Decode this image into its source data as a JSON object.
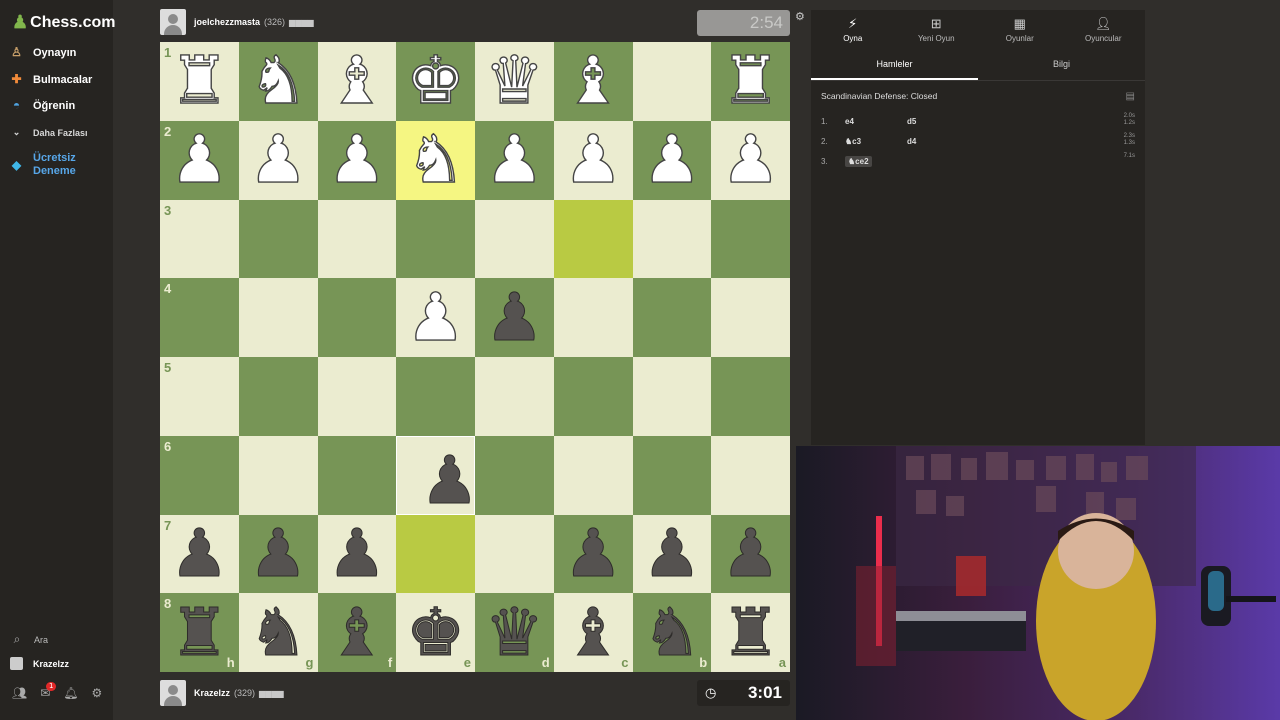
{
  "sidebar": {
    "logo": "Chess.com",
    "items": [
      {
        "label": "Oynayın",
        "icon": "play-icon"
      },
      {
        "label": "Bulmacalar",
        "icon": "puzzle-icon"
      },
      {
        "label": "Öğrenin",
        "icon": "learn-icon"
      },
      {
        "label": "Daha Fazlası",
        "icon": "chevron-down-icon"
      },
      {
        "label": "Ücretsiz Deneme",
        "icon": "diamond-icon"
      }
    ],
    "search_label": "Ara",
    "username": "Krazelzz",
    "notification_count": "1"
  },
  "top_player": {
    "name": "joelchezzmasta",
    "rating": "(326)",
    "clock": "2:54"
  },
  "bottom_player": {
    "name": "Krazelzz",
    "rating": "(329)",
    "clock": "3:01"
  },
  "board": {
    "orientation": "black",
    "ranks": [
      "1",
      "2",
      "3",
      "4",
      "5",
      "6",
      "7",
      "8"
    ],
    "files": [
      "h",
      "g",
      "f",
      "e",
      "d",
      "c",
      "b",
      "a"
    ],
    "pieces": [
      [
        "♜w",
        "♞w",
        "♝w",
        "♚w",
        "♛w",
        "♝w",
        "",
        "♜w"
      ],
      [
        "♟w",
        "♟w",
        "♟w",
        "♞w",
        "♟w",
        "♟w",
        "♟w",
        "♟w"
      ],
      [
        "",
        "",
        "",
        "",
        "",
        "",
        "",
        ""
      ],
      [
        "",
        "",
        "",
        "♟w",
        "♟b",
        "",
        "",
        ""
      ],
      [
        "",
        "",
        "",
        "",
        "",
        "",
        "",
        ""
      ],
      [
        "",
        "",
        "",
        "♟b",
        "",
        "",
        "",
        ""
      ],
      [
        "♟b",
        "♟b",
        "♟b",
        "",
        "",
        "♟b",
        "♟b",
        "♟b"
      ],
      [
        "♜b",
        "♞b",
        "♝b",
        "♚b",
        "♛b",
        "♝b",
        "♞b",
        "♜b"
      ]
    ],
    "highlight_last_move": [
      [
        1,
        3
      ]
    ],
    "highlight_selected": [
      [
        2,
        5
      ],
      [
        6,
        3
      ]
    ],
    "dragging_square": [
      5,
      3
    ]
  },
  "right_panel": {
    "tabs": [
      {
        "label": "Oyna",
        "icon": "bolt-icon"
      },
      {
        "label": "Yeni Oyun",
        "icon": "plus-icon"
      },
      {
        "label": "Oyunlar",
        "icon": "board-icon"
      },
      {
        "label": "Oyuncular",
        "icon": "players-icon"
      }
    ],
    "subtabs": [
      "Hamleler",
      "Bilgi"
    ],
    "opening": "Scandinavian Defense: Closed",
    "moves": [
      {
        "num": "1.",
        "white": "e4",
        "black": "d5",
        "times": [
          "2.0s",
          "1.2s"
        ]
      },
      {
        "num": "2.",
        "white": "♞c3",
        "black": "d4",
        "times": [
          "2.3s",
          "1.3s"
        ]
      },
      {
        "num": "3.",
        "white": "♞ce2",
        "black": "",
        "times": [
          "7.1s"
        ]
      }
    ]
  }
}
